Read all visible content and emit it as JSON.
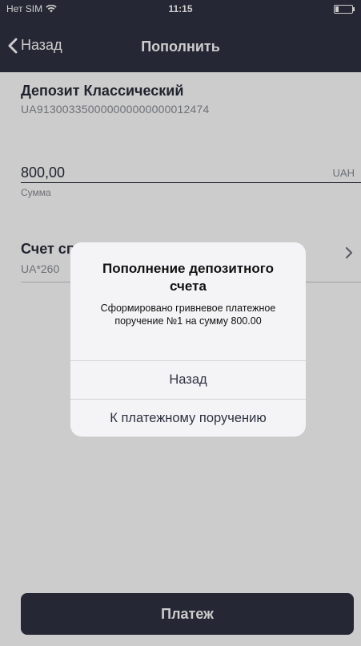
{
  "status_bar": {
    "carrier": "Нет SIM",
    "time": "11:15"
  },
  "nav": {
    "back_label": "Назад",
    "title": "Пополнить"
  },
  "deposit": {
    "name": "Депозит Классический",
    "iban": "UA913003350000000000000012474"
  },
  "amount": {
    "value": "800,00",
    "currency": "UAH",
    "label": "Сумма"
  },
  "account": {
    "title": "Счет сп",
    "number": "UA*260"
  },
  "pay_button": {
    "label": "Платеж"
  },
  "alert": {
    "title": "Пополнение депозитного счета",
    "message": "Сформировано гривневое платежное поручение №1 на сумму 800.00",
    "buttons": [
      "Назад",
      "К платежному поручению"
    ]
  },
  "colors": {
    "header_bg": "#2f3241",
    "overlay": "rgba(0,0,0,0.2)",
    "alert_bg": "#f4f4f6"
  },
  "icons": [
    "wifi-icon",
    "battery-icon",
    "chevron-left-icon",
    "chevron-right-icon"
  ]
}
